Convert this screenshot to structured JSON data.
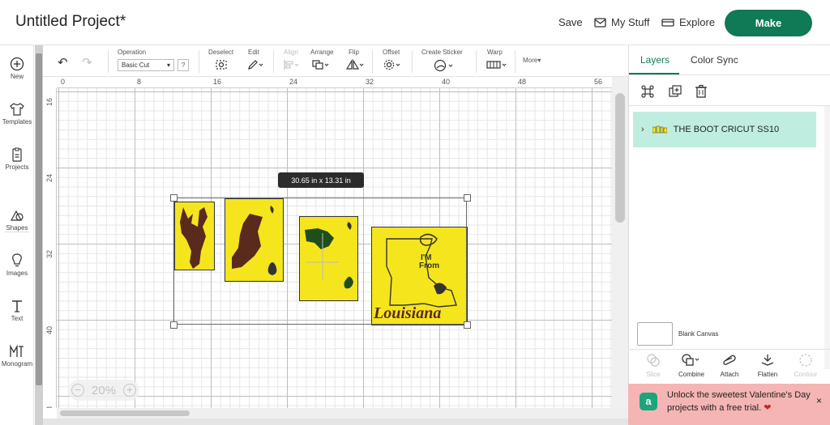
{
  "header": {
    "title": "Untitled Project*",
    "save_label": "Save",
    "mystuff_label": "My Stuff",
    "explore_label": "Explore",
    "make_label": "Make"
  },
  "left_rail": {
    "items": [
      {
        "label": "New",
        "icon": "plus-circle-icon"
      },
      {
        "label": "Templates",
        "icon": "tshirt-icon"
      },
      {
        "label": "Projects",
        "icon": "clipboard-icon"
      },
      {
        "label": "Shapes",
        "icon": "shapes-icon"
      },
      {
        "label": "Images",
        "icon": "lightbulb-icon"
      },
      {
        "label": "Text",
        "icon": "text-icon"
      },
      {
        "label": "Monogram",
        "icon": "monogram-icon"
      }
    ]
  },
  "toolbar": {
    "operation_label": "Operation",
    "operation_value": "Basic Cut",
    "help_label": "?",
    "deselect_label": "Deselect",
    "edit_label": "Edit",
    "align_label": "Align",
    "arrange_label": "Arrange",
    "flip_label": "Flip",
    "offset_label": "Offset",
    "create_sticker_label": "Create Sticker",
    "warp_label": "Warp",
    "more_label": "More"
  },
  "rulers": {
    "top": [
      "0",
      "8",
      "16",
      "24",
      "32",
      "40",
      "48",
      "56"
    ],
    "left": [
      "16",
      "24",
      "32",
      "40",
      "8"
    ]
  },
  "canvas": {
    "dimensions_tooltip": "30.65  in x 13.31  in",
    "zoom_value": "20%",
    "art_texts": [
      "I'M",
      "From",
      "Louisiana"
    ]
  },
  "right_panel": {
    "tabs": [
      "Layers",
      "Color Sync"
    ],
    "layer_name": "THE BOOT CRICUT SS10",
    "blank_canvas_label": "Blank Canvas",
    "tools": [
      {
        "label": "Slice",
        "enabled": false
      },
      {
        "label": "Combine",
        "enabled": true
      },
      {
        "label": "Attach",
        "enabled": true
      },
      {
        "label": "Flatten",
        "enabled": true
      },
      {
        "label": "Contour",
        "enabled": false
      }
    ]
  },
  "promo": {
    "icon_letter": "a",
    "text": "Unlock the sweetest Valentine's Day projects with a free trial.",
    "heart": "❤",
    "close": "×"
  },
  "colors": {
    "accent": "#0f7a55",
    "layer_highlight": "#bfeee0",
    "promo_bg": "#f5b5b5",
    "art_yellow": "#f5e51d"
  }
}
